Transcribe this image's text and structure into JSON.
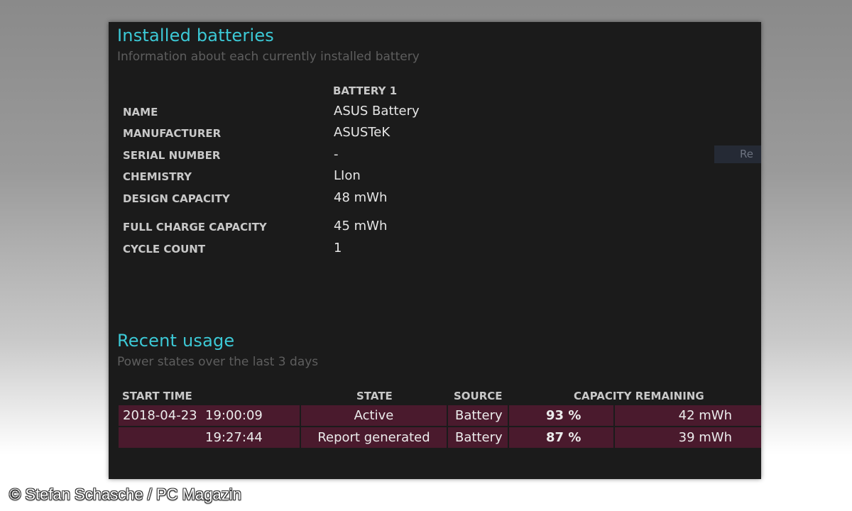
{
  "installed": {
    "title": "Installed batteries",
    "subtitle": "Information about each currently installed battery",
    "column_header": "BATTERY 1",
    "rows": [
      {
        "label": "NAME",
        "value": "ASUS Battery"
      },
      {
        "label": "MANUFACTURER",
        "value": "ASUSTeK"
      },
      {
        "label": "SERIAL NUMBER",
        "value": "-"
      },
      {
        "label": "CHEMISTRY",
        "value": "LIon"
      },
      {
        "label": "DESIGN CAPACITY",
        "value": "48 mWh"
      },
      {
        "label": "FULL CHARGE CAPACITY",
        "value": "45 mWh"
      },
      {
        "label": "CYCLE COUNT",
        "value": "1"
      }
    ]
  },
  "cutoff_button": {
    "label": "Re"
  },
  "recent": {
    "title": "Recent usage",
    "subtitle": "Power states over the last 3 days",
    "headers": {
      "start_time": "START TIME",
      "state": "STATE",
      "source": "SOURCE",
      "capacity_remaining": "CAPACITY REMAINING"
    },
    "rows": [
      {
        "date": "2018-04-23",
        "time": "19:00:09",
        "state": "Active",
        "source": "Battery",
        "percent": "93 %",
        "capacity": "42 mWh"
      },
      {
        "date": "",
        "time": "19:27:44",
        "state": "Report generated",
        "source": "Battery",
        "percent": "87 %",
        "capacity": "39 mWh"
      }
    ]
  },
  "watermark": "© Stefan Schasche / PC Magazin",
  "colors": {
    "accent": "#3cc9d6",
    "panel_bg": "#1b1b1b",
    "row_bg": "#4a1a2d",
    "subtitle": "#5e5e5e"
  }
}
